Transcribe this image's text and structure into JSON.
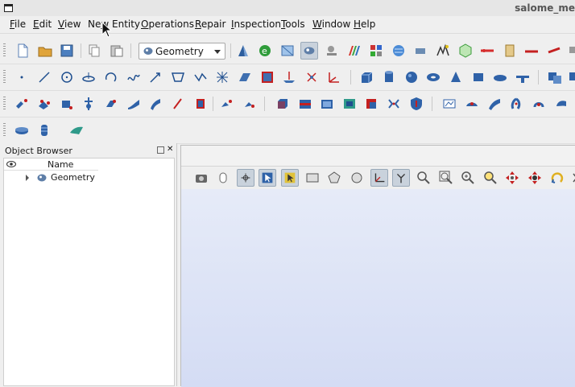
{
  "window": {
    "title": "salome_me"
  },
  "menu": {
    "items": [
      {
        "label": "File",
        "u": "F",
        "rest": "ile"
      },
      {
        "label": "Edit",
        "u": "E",
        "rest": "dit"
      },
      {
        "label": "View",
        "u": "V",
        "rest": "iew"
      },
      {
        "label": "New Entity",
        "pre": "Ne",
        "u": "w",
        "rest": " Entity"
      },
      {
        "label": "Operations",
        "u": "O",
        "rest": "perations"
      },
      {
        "label": "Repair",
        "u": "R",
        "rest": "epair"
      },
      {
        "label": "Inspection",
        "u": "I",
        "rest": "nspection"
      },
      {
        "label": "Tools",
        "u": "T",
        "rest": "ools"
      },
      {
        "label": "Window",
        "u": "W",
        "rest": "indow"
      },
      {
        "label": "Help",
        "u": "H",
        "rest": "elp"
      }
    ]
  },
  "toolbar": {
    "module_selector": {
      "value": "Geometry",
      "icon": "geometry-module-icon"
    }
  },
  "object_browser": {
    "title": "Object Browser",
    "column_name": "Name",
    "root_item": {
      "label": "Geometry",
      "icon": "geometry-module-icon"
    }
  },
  "colors": {
    "viewer_top": "#e6ebf8",
    "viewer_bottom": "#d4dcf4",
    "accent_blue": "#2f6fb0"
  }
}
